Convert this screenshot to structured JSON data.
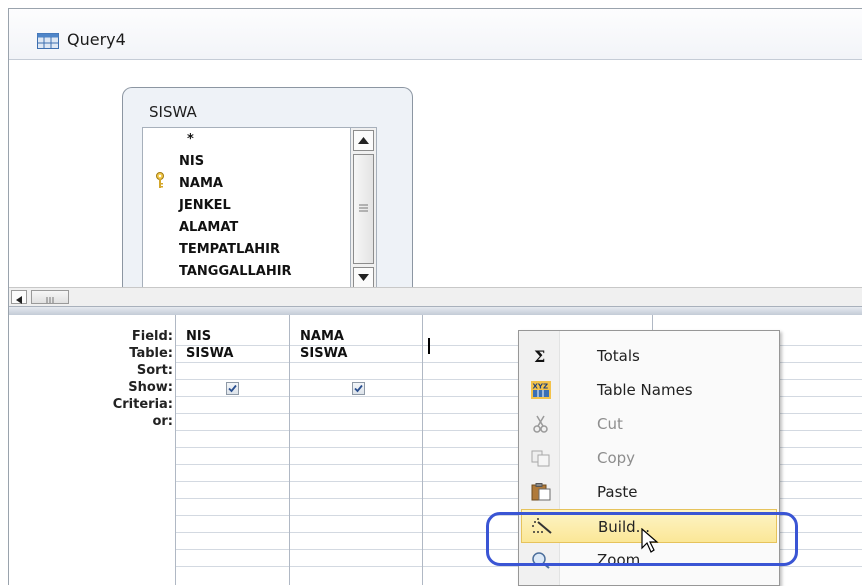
{
  "window": {
    "title": "Query4"
  },
  "table": {
    "name": "SISWA",
    "fields": [
      "*",
      "NIS",
      "NAMA",
      "JENKEL",
      "ALAMAT",
      "TEMPATLAHIR",
      "TANGGALLAHIR"
    ],
    "primary_key": "NIS"
  },
  "grid": {
    "row_labels": {
      "field": "Field:",
      "table": "Table:",
      "sort": "Sort:",
      "show": "Show:",
      "criteria": "Criteria:",
      "or": "or:"
    },
    "columns": [
      {
        "field": "NIS",
        "table": "SISWA",
        "show": true
      },
      {
        "field": "NAMA",
        "table": "SISWA",
        "show": true
      },
      {
        "field": "",
        "table": "",
        "show": true
      }
    ]
  },
  "context_menu": {
    "items": [
      {
        "label": "Totals",
        "icon": "sigma-icon",
        "enabled": true
      },
      {
        "label": "Table Names",
        "icon": "xyz-table-icon",
        "enabled": true
      },
      {
        "label": "Cut",
        "icon": "scissors-icon",
        "enabled": false
      },
      {
        "label": "Copy",
        "icon": "copy-icon",
        "enabled": false
      },
      {
        "label": "Paste",
        "icon": "paste-icon",
        "enabled": true
      },
      {
        "label": "Build...",
        "icon": "build-wand-icon",
        "enabled": true,
        "highlighted": true
      },
      {
        "label": "Zoom...",
        "icon": "magnifier-icon",
        "enabled": true
      }
    ]
  },
  "colors": {
    "highlight_outline": "#3a55d4",
    "menu_highlight": "#fbe797"
  }
}
